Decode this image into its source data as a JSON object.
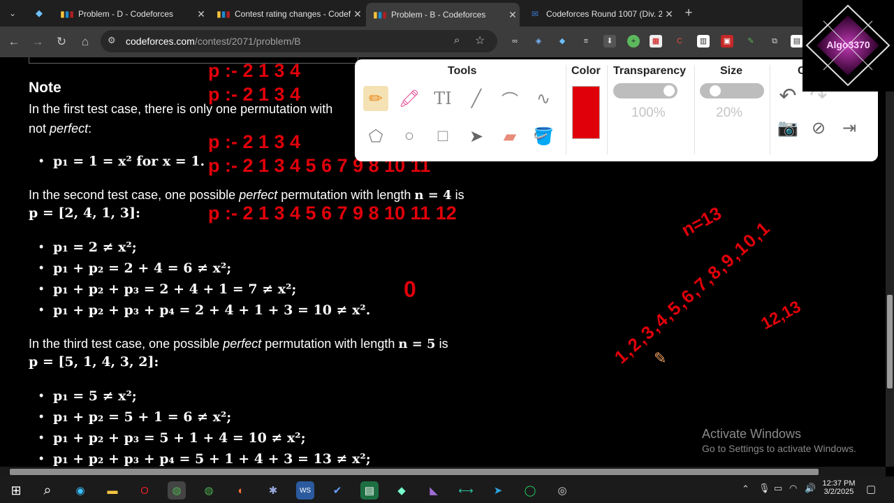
{
  "tabs": [
    {
      "title": "Problem - D - Codeforces"
    },
    {
      "title": "Contest rating changes - Codef"
    },
    {
      "title": "Problem - B - Codeforces"
    },
    {
      "title": "Codeforces Round 1007 (Div. 2)"
    }
  ],
  "address": {
    "host": "codeforces.com",
    "path": "/contest/2071/problem/B"
  },
  "note": {
    "heading": "Note",
    "line1a": "In the first test case, there is only one permutation with",
    "line1b": "not",
    "line1c": "perfect",
    "case1_bullet": "p₁ = 1 = x² for x = 1.",
    "second_a": "In the second test case, one possible",
    "second_b": "perfect",
    "second_c": "permutation with length",
    "second_n": "n = 4",
    "second_is": "is",
    "second_p": "p = [2, 4, 1, 3]:",
    "case2_bullets": [
      "p₁ = 2 ≠ x²;",
      "p₁ + p₂ = 2 + 4 = 6 ≠ x²;",
      "p₁ + p₂ + p₃ = 2 + 4 + 1 = 7 ≠ x²;",
      "p₁ + p₂ + p₃ + p₄ = 2 + 4 + 1 + 3 = 10 ≠ x²."
    ],
    "third_a": "In the third test case, one possible",
    "third_b": "perfect",
    "third_c": "permutation with length",
    "third_n": "n = 5",
    "third_is": "is",
    "third_p": "p = [5, 1, 4, 3, 2]:",
    "case3_bullets": [
      "p₁ = 5 ≠ x²;",
      "p₁ + p₂ = 5 + 1 = 6 ≠ x²;",
      "p₁ + p₂ + p₃ = 5 + 1 + 4 = 10 ≠ x²;",
      "p₁ + p₂ + p₃ + p₄ = 5 + 1 + 4 + 3 = 13 ≠ x²;"
    ]
  },
  "annotations": {
    "row1": "p :- 2  1  3  4",
    "row2": "p :- 2  1  3  4",
    "row3": "p :- 2   1  3  4",
    "row4": "p :- 2   1   3  4  5  6   7   9  8   10  11",
    "row5": "p :-  2    1   3   4   5   6    7    9   8     10   11   12",
    "zero": "0",
    "n_label": "n=13",
    "seq": "1,2,3,4,5,6,7,8,9,10,1",
    "pair": "12,13"
  },
  "tools_panel": {
    "tools_label": "Tools",
    "color_label": "Color",
    "transparency_label": "Transparency",
    "size_label": "Size",
    "c_label": "C",
    "transparency_value": "100%",
    "size_value": "20%",
    "selected_color": "#e0000a"
  },
  "watermark": {
    "line1": "Activate Windows",
    "line2": "Go to Settings to activate Windows."
  },
  "clock": {
    "time": "12:37 PM",
    "date": "3/2/2025"
  },
  "logo_text": "Algo3370"
}
